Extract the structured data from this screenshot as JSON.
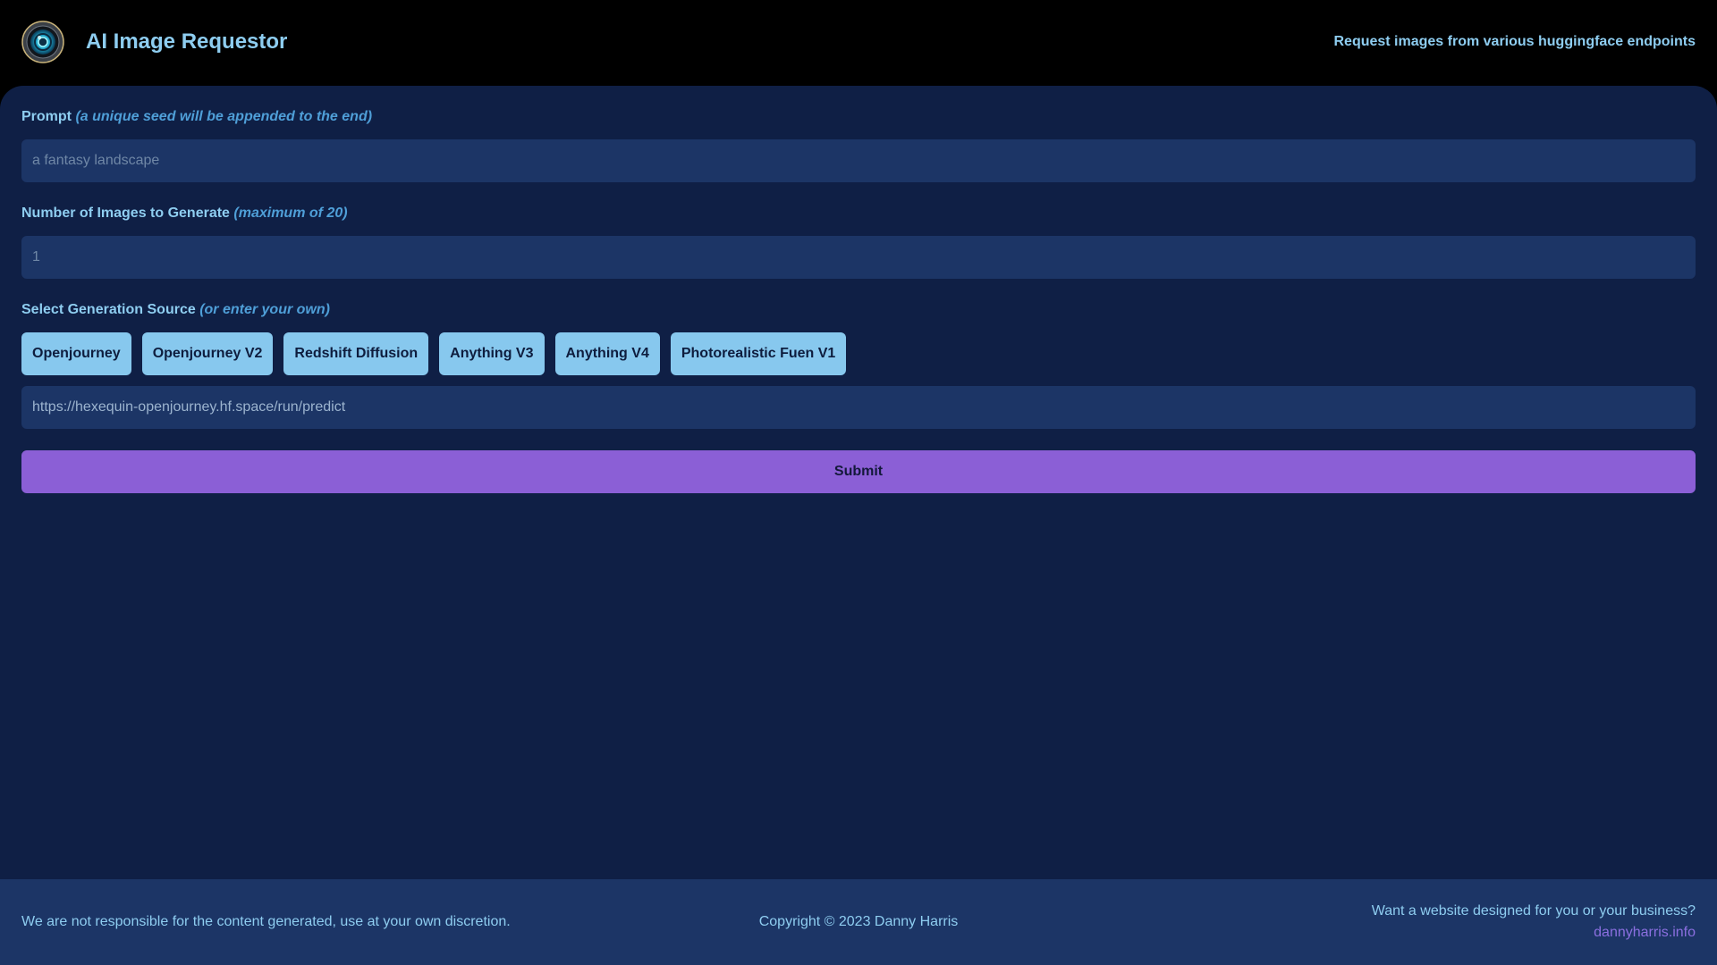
{
  "header": {
    "title": "AI Image Requestor",
    "tagline": "Request images from various huggingface endpoints",
    "logo_icon": "camera-lens-icon"
  },
  "form": {
    "prompt": {
      "label": "Prompt",
      "hint": "(a unique seed will be appended to the end)",
      "placeholder": "a fantasy landscape",
      "value": ""
    },
    "count": {
      "label": "Number of Images to Generate",
      "hint": "(maximum of 20)",
      "placeholder": "1",
      "value": ""
    },
    "source": {
      "label": "Select Generation Source",
      "hint": "(or enter your own)",
      "options": [
        "Openjourney",
        "Openjourney V2",
        "Redshift Diffusion",
        "Anything V3",
        "Anything V4",
        "Photorealistic Fuen V1"
      ],
      "url_value": "https://hexequin-openjourney.hf.space/run/predict"
    },
    "submit_label": "Submit"
  },
  "footer": {
    "disclaimer": "We are not responsible for the content generated, use at your own discretion.",
    "copyright": "Copyright © 2023 Danny Harris",
    "promo_text": "Want a website designed for you or your business?",
    "promo_link": "dannyharris.info"
  },
  "colors": {
    "background": "#000000",
    "panel": "#0f1f45",
    "input": "#1c3566",
    "accent_text": "#8ecdf0",
    "hint_text": "#4f9fd8",
    "source_button": "#87c8ee",
    "submit_button": "#8b5fd6",
    "link": "#8b6fe0"
  }
}
